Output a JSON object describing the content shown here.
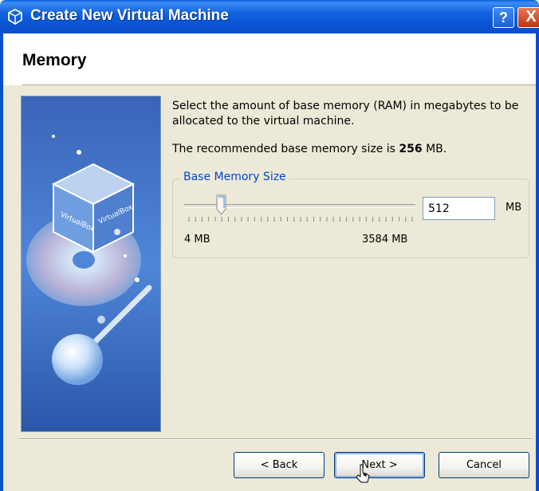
{
  "window": {
    "title": "Create New Virtual Machine",
    "help_button": "?",
    "close_button": "X"
  },
  "page": {
    "title": "Memory",
    "description": "Select the amount of base memory (RAM) in megabytes to be allocated to the virtual machine.",
    "recommended_prefix": "The recommended base memory size is ",
    "recommended_value": "256",
    "recommended_suffix": " MB."
  },
  "memory": {
    "group_label": "Base Memory Size",
    "min_label": "4 MB",
    "max_label": "3584 MB",
    "value": "512",
    "unit": "MB",
    "slider_fraction": 0.142
  },
  "buttons": {
    "back": "< Back",
    "next": "Next >",
    "cancel": "Cancel"
  },
  "illustration": {
    "box_text_left": "VirtualBox",
    "box_text_right": "VirtualBox"
  },
  "colors": {
    "title_bar": "#0a55d4",
    "group_label": "#0046d5",
    "face": "#ece9d8"
  }
}
